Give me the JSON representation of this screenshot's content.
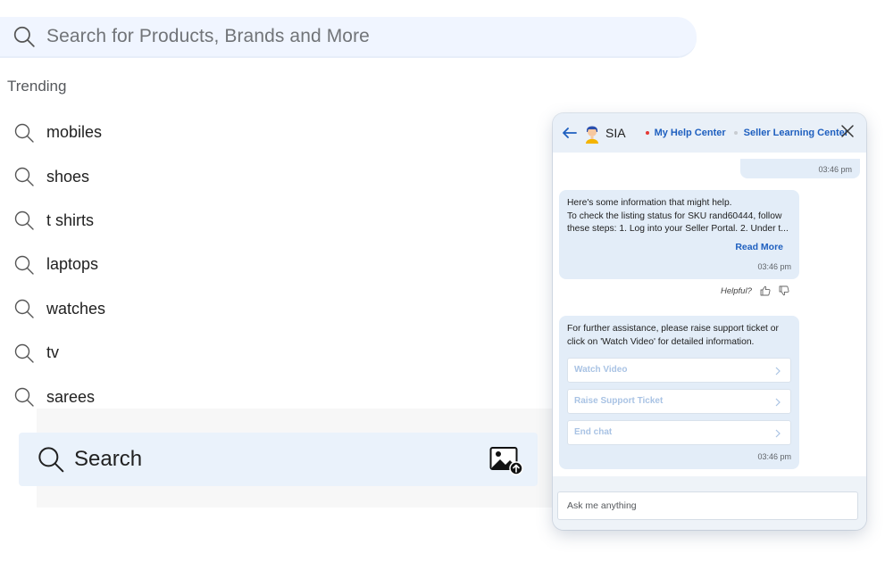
{
  "search": {
    "placeholder": "Search for Products, Brands and More"
  },
  "trending": {
    "title": "Trending",
    "items": [
      {
        "label": "mobiles"
      },
      {
        "label": "shoes"
      },
      {
        "label": "t shirts"
      },
      {
        "label": "laptops"
      },
      {
        "label": "watches"
      },
      {
        "label": "tv"
      },
      {
        "label": "sarees"
      }
    ]
  },
  "search_button": {
    "label": "Search",
    "image_icon": "image-upload-icon"
  },
  "chat": {
    "assistant_name": "SIA",
    "links": [
      "My Help Center",
      "Seller Learning Center"
    ],
    "messages": [
      {
        "from": "user",
        "time": "03:46 pm"
      },
      {
        "from": "bot",
        "text": "Here's some information that might help.\nTo check the listing status for SKU rand60444, follow these steps: 1. Log into your Seller Portal. 2. Under t...",
        "read_more": "Read More",
        "time": "03:46 pm"
      },
      {
        "from": "bot",
        "text": "For further assistance, please raise support ticket or click on 'Watch Video' for detailed information.",
        "time": "03:46 pm"
      }
    ],
    "helpful_label": "Helpful?",
    "actions": [
      "Watch Video",
      "Raise Support Ticket",
      "End chat"
    ],
    "input_placeholder": "Ask me anything"
  },
  "colors": {
    "search_bg": "#f0f5ff",
    "bubble_bg": "#e3edf8",
    "link_blue": "#1e5fbf",
    "action_text": "#a9c3e4"
  }
}
